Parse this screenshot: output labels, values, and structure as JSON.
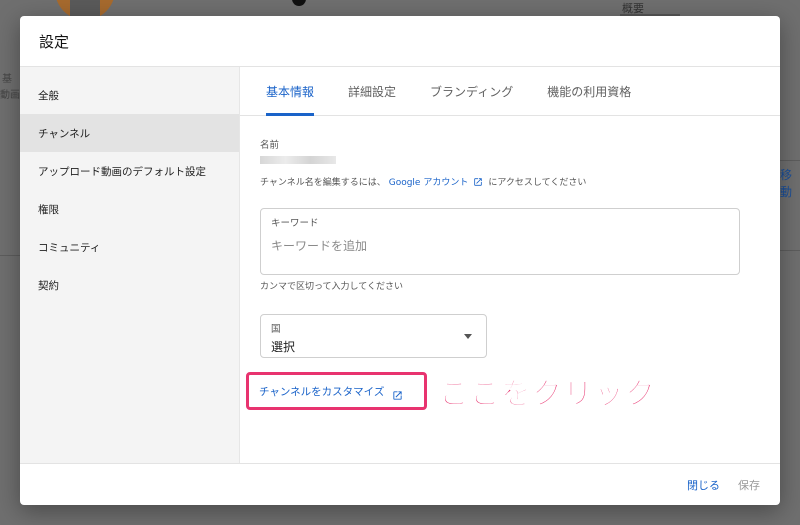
{
  "background": {
    "right_text": "概要",
    "move_link": "移動",
    "left_texts": [
      "基",
      "動画"
    ]
  },
  "dialog": {
    "title": "設定"
  },
  "sidebar": {
    "items": [
      {
        "label": "全般",
        "active": false
      },
      {
        "label": "チャンネル",
        "active": true
      },
      {
        "label": "アップロード動画のデフォルト設定",
        "active": false
      },
      {
        "label": "権限",
        "active": false
      },
      {
        "label": "コミュニティ",
        "active": false
      },
      {
        "label": "契約",
        "active": false
      }
    ]
  },
  "tabs": [
    {
      "label": "基本情報",
      "active": true
    },
    {
      "label": "詳細設定",
      "active": false
    },
    {
      "label": "ブランディング",
      "active": false
    },
    {
      "label": "機能の利用資格",
      "active": false
    }
  ],
  "name_section": {
    "label": "名前",
    "help_prefix": "チャンネル名を編集するには、",
    "help_link": "Google アカウント",
    "help_suffix": "にアクセスしてください"
  },
  "keyword": {
    "label": "キーワード",
    "placeholder": "キーワードを追加",
    "value": "",
    "help": "カンマで区切って入力してください"
  },
  "country": {
    "label": "国",
    "value": "選択"
  },
  "customize": {
    "link": "チャンネルをカスタマイズ",
    "annotation": "ここをクリック"
  },
  "footer": {
    "close_label": "閉じる",
    "save_label": "保存"
  },
  "colors": {
    "accent": "#1a63c9",
    "highlight": "#e8336f"
  }
}
